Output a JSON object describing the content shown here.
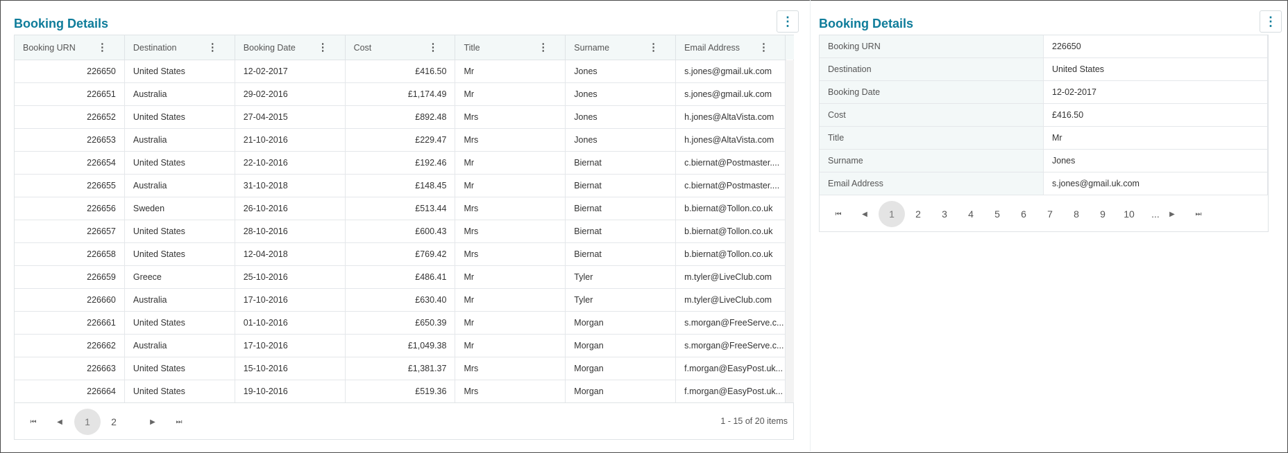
{
  "left_panel": {
    "title": "Booking Details",
    "columns": [
      "Booking URN",
      "Destination",
      "Booking Date",
      "Cost",
      "Title",
      "Surname",
      "Email Address"
    ],
    "rows": [
      [
        "226650",
        "United States",
        "12-02-2017",
        "£416.50",
        "Mr",
        "Jones",
        "s.jones@gmail.uk.com"
      ],
      [
        "226651",
        "Australia",
        "29-02-2016",
        "£1,174.49",
        "Mr",
        "Jones",
        "s.jones@gmail.uk.com"
      ],
      [
        "226652",
        "United States",
        "27-04-2015",
        "£892.48",
        "Mrs",
        "Jones",
        "h.jones@AltaVista.com"
      ],
      [
        "226653",
        "Australia",
        "21-10-2016",
        "£229.47",
        "Mrs",
        "Jones",
        "h.jones@AltaVista.com"
      ],
      [
        "226654",
        "United States",
        "22-10-2016",
        "£192.46",
        "Mr",
        "Biernat",
        "c.biernat@Postmaster...."
      ],
      [
        "226655",
        "Australia",
        "31-10-2018",
        "£148.45",
        "Mr",
        "Biernat",
        "c.biernat@Postmaster...."
      ],
      [
        "226656",
        "Sweden",
        "26-10-2016",
        "£513.44",
        "Mrs",
        "Biernat",
        "b.biernat@Tollon.co.uk"
      ],
      [
        "226657",
        "United States",
        "28-10-2016",
        "£600.43",
        "Mrs",
        "Biernat",
        "b.biernat@Tollon.co.uk"
      ],
      [
        "226658",
        "United States",
        "12-04-2018",
        "£769.42",
        "Mrs",
        "Biernat",
        "b.biernat@Tollon.co.uk"
      ],
      [
        "226659",
        "Greece",
        "25-10-2016",
        "£486.41",
        "Mr",
        "Tyler",
        "m.tyler@LiveClub.com"
      ],
      [
        "226660",
        "Australia",
        "17-10-2016",
        "£630.40",
        "Mr",
        "Tyler",
        "m.tyler@LiveClub.com"
      ],
      [
        "226661",
        "United States",
        "01-10-2016",
        "£650.39",
        "Mr",
        "Morgan",
        "s.morgan@FreeServe.c..."
      ],
      [
        "226662",
        "Australia",
        "17-10-2016",
        "£1,049.38",
        "Mr",
        "Morgan",
        "s.morgan@FreeServe.c..."
      ],
      [
        "226663",
        "United States",
        "15-10-2016",
        "£1,381.37",
        "Mrs",
        "Morgan",
        "f.morgan@EasyPost.uk..."
      ],
      [
        "226664",
        "United States",
        "19-10-2016",
        "£519.36",
        "Mrs",
        "Morgan",
        "f.morgan@EasyPost.uk..."
      ]
    ],
    "pager": {
      "pages": [
        "1",
        "2"
      ],
      "active": "1",
      "info": "1 - 15 of 20 items"
    }
  },
  "right_panel": {
    "title": "Booking Details",
    "fields": [
      {
        "label": "Booking URN",
        "value": "226650"
      },
      {
        "label": "Destination",
        "value": "United States"
      },
      {
        "label": "Booking Date",
        "value": "12-02-2017"
      },
      {
        "label": "Cost",
        "value": "£416.50"
      },
      {
        "label": "Title",
        "value": "Mr"
      },
      {
        "label": "Surname",
        "value": "Jones"
      },
      {
        "label": "Email Address",
        "value": "s.jones@gmail.uk.com"
      }
    ],
    "pager": {
      "pages": [
        "1",
        "2",
        "3",
        "4",
        "5",
        "6",
        "7",
        "8",
        "9",
        "10",
        "..."
      ],
      "active": "1"
    }
  },
  "icons": {
    "kebab": "⋮",
    "first": "⏮",
    "prev": "◀",
    "next": "▶",
    "last": "⏭"
  },
  "colors": {
    "accent": "#0e7c9a",
    "header_bg": "#f3f8f8",
    "active_page_bg": "#e4e4e4"
  }
}
